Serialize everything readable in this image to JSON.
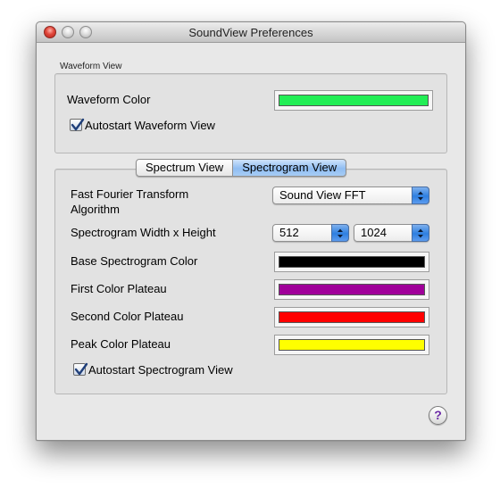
{
  "window": {
    "title": "SoundView Preferences"
  },
  "waveform": {
    "section_label": "Waveform View",
    "color_label": "Waveform Color",
    "color": "#22ee55",
    "autostart_label": "Autostart Waveform View",
    "autostart_checked": true
  },
  "tabs": [
    {
      "label": "Spectrum View",
      "selected": false
    },
    {
      "label": "Spectrogram View",
      "selected": true
    }
  ],
  "spectrogram": {
    "fft_label_line1": "Fast Fourier Transform",
    "fft_label_line2": "Algorithm",
    "fft_value": "Sound View FFT",
    "size_label": "Spectrogram Width x Height",
    "width_value": "512",
    "height_value": "1024",
    "base_color_label": "Base Spectrogram Color",
    "base_color": "#000000",
    "first_plateau_label": "First Color Plateau",
    "first_plateau_color": "#a0009a",
    "second_plateau_label": "Second Color Plateau",
    "second_plateau_color": "#ff0000",
    "peak_plateau_label": "Peak Color Plateau",
    "peak_plateau_color": "#ffff00",
    "autostart_label": "Autostart Spectrogram View",
    "autostart_checked": true
  },
  "help": {
    "glyph": "?"
  },
  "icons": {
    "close": "close-button-icon",
    "minimize": "minimize-button-icon",
    "zoom": "zoom-button-icon",
    "popup_arrows": "up-down-arrows-icon",
    "checkmark": "checkmark-icon",
    "help": "question-mark-icon"
  }
}
